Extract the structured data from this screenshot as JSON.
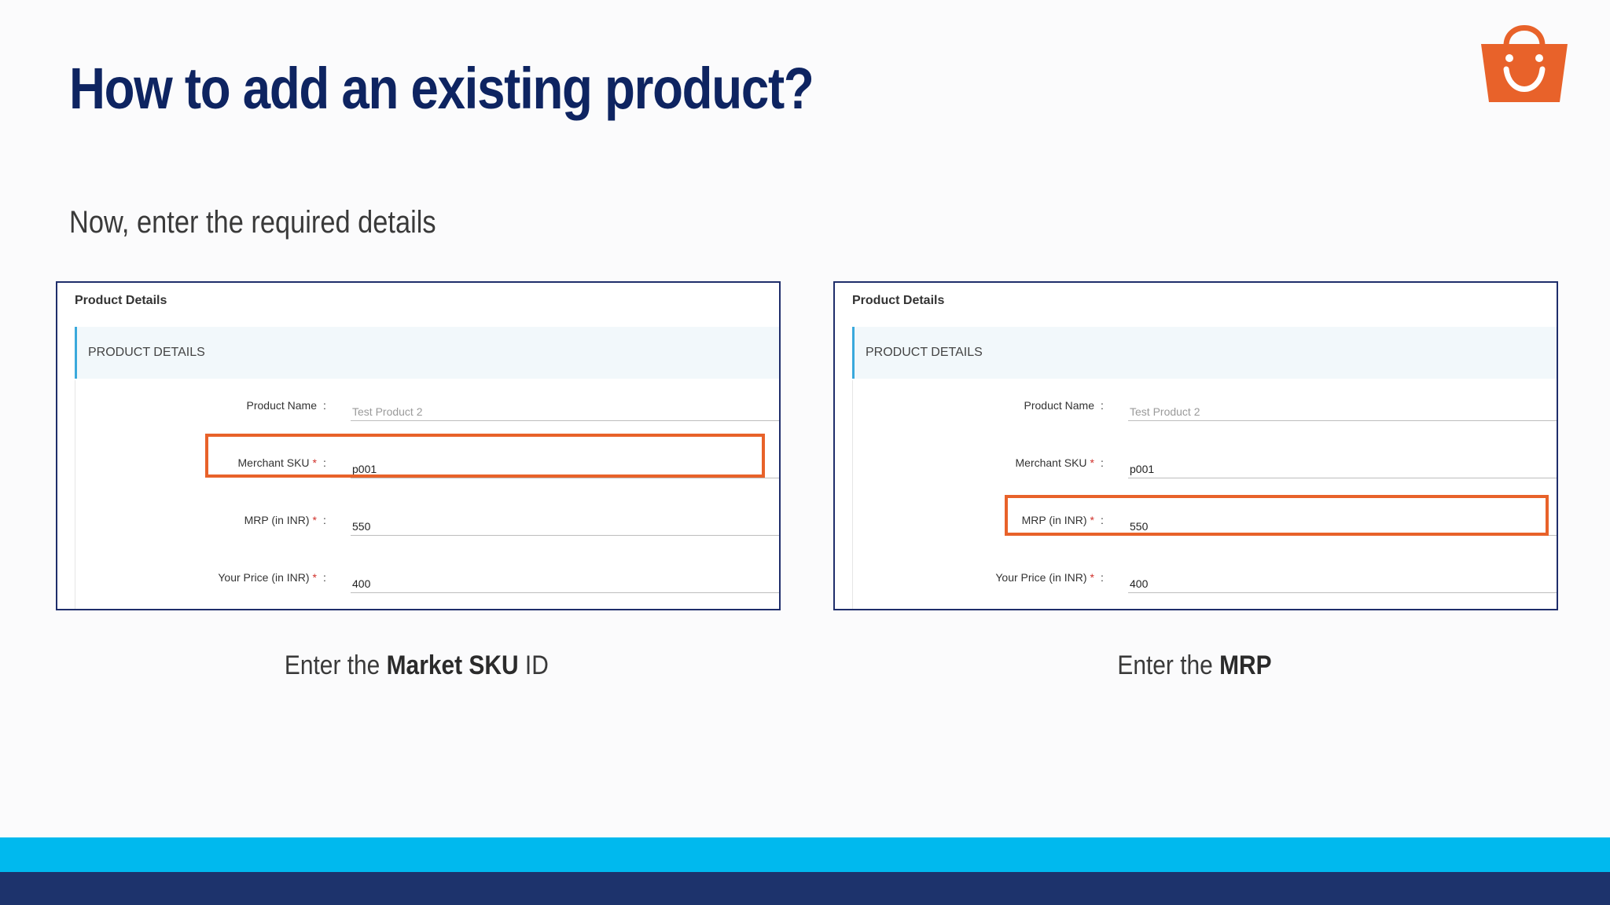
{
  "slide": {
    "title": "How to add an existing product?",
    "subtitle": "Now, enter the required details"
  },
  "logo": {
    "icon": "shopping-bag-icon",
    "color": "#e8622a"
  },
  "panels": [
    {
      "panel_title": "Product Details",
      "section_label": "PRODUCT DETAILS",
      "fields": [
        {
          "label": "Product Name",
          "required": false,
          "value": "Test Product 2",
          "placeholder": true
        },
        {
          "label": "Merchant SKU",
          "required": true,
          "value": "p001",
          "placeholder": false
        },
        {
          "label": "MRP (in INR)",
          "required": true,
          "value": "550",
          "placeholder": false
        },
        {
          "label": "Your Price (in INR)",
          "required": true,
          "value": "400",
          "placeholder": false
        }
      ],
      "highlighted_field": "Merchant SKU",
      "caption_prefix": "Enter the ",
      "caption_bold": "Market SKU",
      "caption_suffix": " ID"
    },
    {
      "panel_title": "Product Details",
      "section_label": "PRODUCT DETAILS",
      "fields": [
        {
          "label": "Product Name",
          "required": false,
          "value": "Test Product 2",
          "placeholder": true
        },
        {
          "label": "Merchant SKU",
          "required": true,
          "value": "p001",
          "placeholder": false
        },
        {
          "label": "MRP (in INR)",
          "required": true,
          "value": "550",
          "placeholder": false
        },
        {
          "label": "Your Price (in INR)",
          "required": true,
          "value": "400",
          "placeholder": false
        }
      ],
      "highlighted_field": "MRP (in INR)",
      "caption_prefix": "Enter the ",
      "caption_bold": "MRP",
      "caption_suffix": ""
    }
  ],
  "colors": {
    "title": "#0e2461",
    "highlight": "#e8622a",
    "band_light": "#00b9ee",
    "band_dark": "#1d336c",
    "required_star": "#d0302a"
  },
  "required_marker": "*",
  "colon": ":"
}
